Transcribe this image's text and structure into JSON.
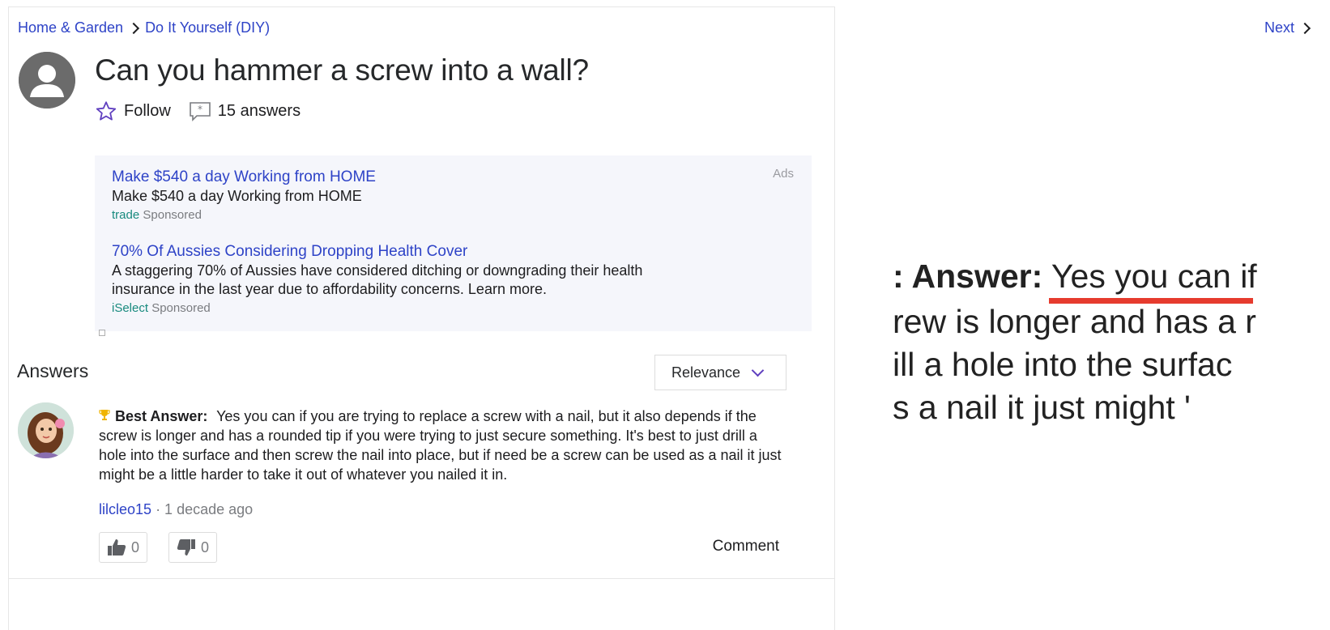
{
  "breadcrumb": {
    "items": [
      "Home & Garden",
      "Do It Yourself (DIY)"
    ],
    "next": "Next"
  },
  "question": {
    "title": "Can you hammer a screw into a wall?",
    "follow": "Follow",
    "answers_count": "15 answers"
  },
  "ads": {
    "label": "Ads",
    "items": [
      {
        "headline": "Make $540 a day Working from HOME",
        "description": "Make $540 a day Working from HOME",
        "source": "trade",
        "sponsored": "Sponsored"
      },
      {
        "headline": "70% Of Aussies Considering Dropping Health Cover",
        "description_line1": "A staggering 70% of Aussies have considered ditching or downgrading their health",
        "description_line2": "insurance in the last year due to affordability concerns. Learn more.",
        "source": "iSelect",
        "sponsored": "Sponsored"
      }
    ]
  },
  "answers": {
    "heading": "Answers",
    "sort": "Relevance",
    "best": {
      "label": "Best Answer:",
      "text": "Yes you can if you are trying to replace a screw with a nail, but it also depends if the screw is longer and has a rounded tip if you were trying to just secure something. It's best to just drill a hole into the surface and then screw the nail into place, but if need be a screw can be used as a nail it just might be a little harder to take it out of whatever you nailed it in.",
      "user": "lilcleo15",
      "time": "· 1 decade ago",
      "upvotes": "0",
      "downvotes": "0",
      "comment": "Comment"
    }
  },
  "zoom": {
    "line1": ": Answer:  Yes you can if",
    "line2": "rew is longer and has a r",
    "line3": "ill a hole into the surfac",
    "line4": "s a nail it just might '"
  },
  "colors": {
    "link": "#2e43c7",
    "accent_purple": "#5f3fbf",
    "underline_red": "#e63b2e",
    "ad_bg": "#f5f6fb"
  },
  "icons": [
    "star-outline-icon",
    "answers-icon",
    "chevron-right-icon",
    "chevron-down-icon",
    "trophy-icon",
    "thumbs-up-icon",
    "thumbs-down-icon",
    "user-avatar-icon"
  ]
}
